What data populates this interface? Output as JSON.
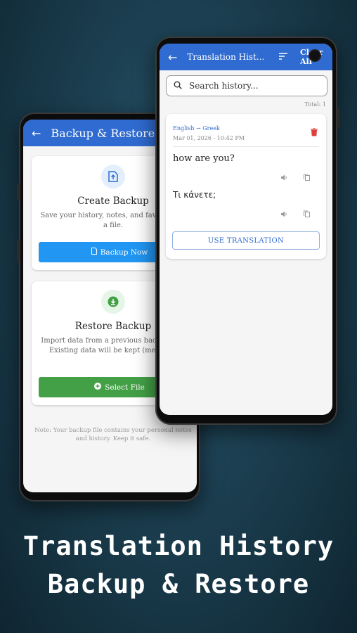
{
  "left_screen": {
    "title": "Backup & Restore",
    "create": {
      "title": "Create Backup",
      "desc": "Save your history, notes, and favorites to a file.",
      "button": "Backup Now"
    },
    "restore": {
      "title": "Restore Backup",
      "desc": "Import data from a previous backup file. Existing data will be kept (merged).",
      "button": "Select File"
    },
    "note": "Note: Your backup file contains your personal notes and history. Keep it safe."
  },
  "right_screen": {
    "title": "Translation Hist...",
    "clear_label": "Clear All",
    "search_placeholder": "Search history...",
    "total": "Total: 1",
    "entry": {
      "languages": "English → Greek",
      "date": "Mar 01, 2026 - 10:42 PM",
      "source": "how are you?",
      "translation": "Τι κάνετε;",
      "use_button": "USE TRANSLATION"
    }
  },
  "caption": {
    "line1": "Translation History",
    "line2": "Backup & Restore"
  },
  "colors": {
    "primary": "#2f6bd0",
    "backup_button": "#2196f3",
    "select_button": "#43a047",
    "delete": "#e0403a"
  }
}
